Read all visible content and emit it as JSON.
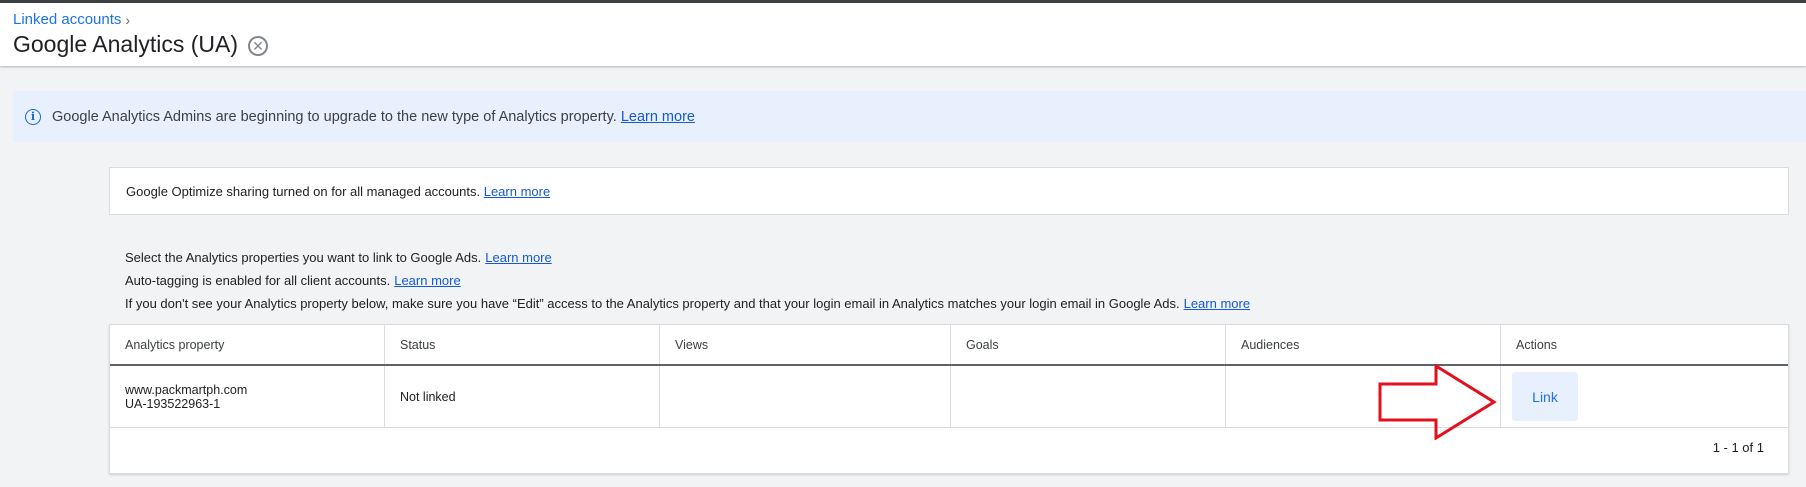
{
  "breadcrumb": {
    "label": "Linked accounts",
    "chevron": "›"
  },
  "title": "Google Analytics (UA)",
  "banner": {
    "text": "Google Analytics Admins are beginning to upgrade to the new type of Analytics property.",
    "link": "Learn more"
  },
  "optimize": {
    "text": "Google Optimize sharing turned on for all managed accounts.",
    "link": "Learn more"
  },
  "descriptions": [
    {
      "text": "Select the Analytics properties you want to link to Google Ads.",
      "link": "Learn more"
    },
    {
      "text": "Auto-tagging is enabled for all client accounts.",
      "link": "Learn more"
    },
    {
      "text": "If you don't see your Analytics property below, make sure you have “Edit” access to the Analytics property and that your login email in Analytics matches your login email in Google Ads.",
      "link": "Learn more"
    }
  ],
  "table": {
    "columns": [
      "Analytics property",
      "Status",
      "Views",
      "Goals",
      "Audiences",
      "Actions"
    ],
    "rows": [
      {
        "property_name": "www.packmartph.com",
        "property_id": "UA-193522963-1",
        "status": "Not linked",
        "views": "",
        "goals": "",
        "audiences": "",
        "action": "Link"
      }
    ],
    "pagination": "1 - 1 of 1"
  },
  "colors": {
    "accent": "#1a73e8",
    "banner_bg": "#e8f0fe",
    "annotation_arrow": "#e3101e"
  },
  "icons": {
    "info": "info-icon",
    "close": "close-circle-icon",
    "chevron": "chevron-right-icon",
    "annotation": "red-arrow-annotation"
  }
}
